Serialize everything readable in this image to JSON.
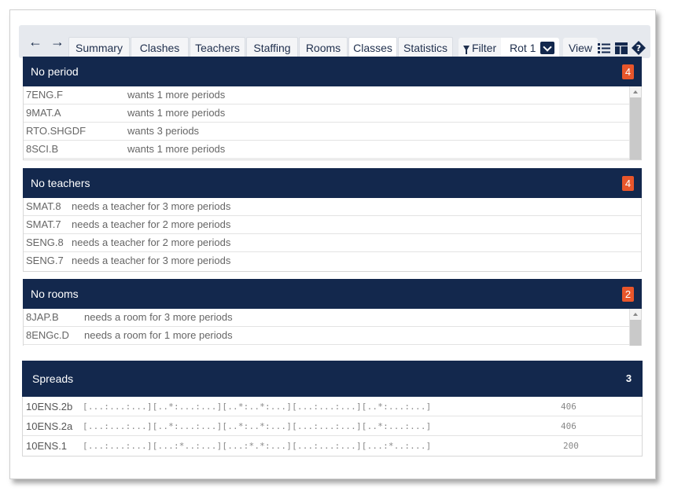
{
  "toolbar": {
    "tabs": [
      {
        "label": "Summary"
      },
      {
        "label": "Clashes"
      },
      {
        "label": "Teachers"
      },
      {
        "label": "Staffing"
      },
      {
        "label": "Rooms"
      },
      {
        "label": "Classes"
      },
      {
        "label": "Statistics"
      }
    ],
    "filter_label": "Filter",
    "rotation_label": "Rot 1",
    "view_label": "View"
  },
  "no_period": {
    "title": "No period",
    "count": "4",
    "rows": [
      {
        "code": "7ENG.F",
        "text": "wants 1 more periods"
      },
      {
        "code": "9MAT.A",
        "text": "wants 1 more periods"
      },
      {
        "code": "RTO.SHGDF",
        "text": "wants 3 periods"
      },
      {
        "code": "8SCI.B",
        "text": "wants 1 more periods"
      }
    ]
  },
  "no_teachers": {
    "title": "No teachers",
    "count": "4",
    "rows": [
      {
        "code": "SMAT.8",
        "text": "needs a teacher for 3 more periods"
      },
      {
        "code": "SMAT.7",
        "text": "needs a teacher for 2 more periods"
      },
      {
        "code": "SENG.8",
        "text": "needs a teacher for 2 more periods"
      },
      {
        "code": "SENG.7",
        "text": "needs a teacher for 3 more periods"
      }
    ]
  },
  "no_rooms": {
    "title": "No rooms",
    "count": "2",
    "rows": [
      {
        "code": "8JAP.B",
        "text": "needs a room for 3 more periods"
      },
      {
        "code": "8ENGc.D",
        "text": "needs a room for 1 more periods"
      }
    ]
  },
  "spreads": {
    "title": "Spreads",
    "count": "3",
    "rows": [
      {
        "code": "10ENS.2b",
        "pattern": "[...:...:...][..*:...:...][..*:..*:...][...:...:...][..*:...:...]",
        "value": "406"
      },
      {
        "code": "10ENS.2a",
        "pattern": "[...:...:...][..*:...:...][..*:..*:...][...:...:...][..*:...:...]",
        "value": "406"
      },
      {
        "code": "10ENS.1",
        "pattern": "[...:...:...][...:*..:...][...:*.*:...][...:...:...][...:*..:...]",
        "value": "200"
      }
    ]
  },
  "colors": {
    "header_bg": "#13284d",
    "badge_bg": "#e8562b",
    "toolbar_bg": "#e6e9ee"
  },
  "icons": [
    "back-arrow-icon",
    "forward-arrow-icon",
    "filter-icon",
    "chevron-down-icon",
    "list-view-icon",
    "table-view-icon",
    "help-icon"
  ]
}
